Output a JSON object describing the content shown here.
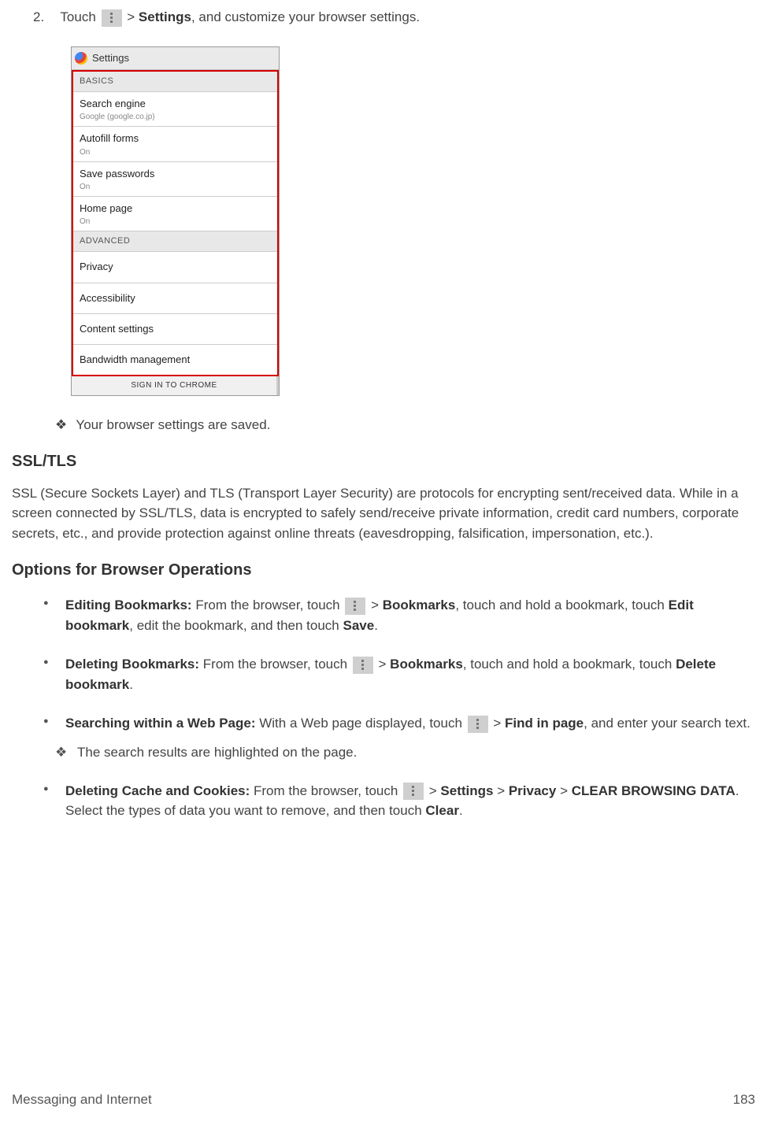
{
  "step": {
    "number": "2.",
    "pre": "Touch ",
    "post_gt": " > ",
    "settings": "Settings",
    "rest": ", and customize your browser settings."
  },
  "screenshot": {
    "title": "Settings",
    "section_basics": "BASICS",
    "items_basic": [
      {
        "title": "Search engine",
        "sub": "Google (google.co.jp)"
      },
      {
        "title": "Autofill forms",
        "sub": "On"
      },
      {
        "title": "Save passwords",
        "sub": "On"
      },
      {
        "title": "Home page",
        "sub": "On"
      }
    ],
    "section_advanced": "ADVANCED",
    "items_advanced": [
      "Privacy",
      "Accessibility",
      "Content settings",
      "Bandwidth management"
    ],
    "footer": "SIGN IN TO CHROME"
  },
  "saved_note": "Your browser settings are saved.",
  "ssl_heading": "SSL/TLS",
  "ssl_para": "SSL (Secure Sockets Layer) and TLS (Transport Layer Security) are protocols for encrypting sent/received data. While in a screen connected by SSL/TLS, data is encrypted to safely send/receive private information, credit card numbers, corporate secrets, etc., and provide protection against online threats (eavesdropping, falsification, impersonation, etc.).",
  "ops_heading": "Options for Browser Operations",
  "ops": {
    "edit": {
      "label": "Editing Bookmarks:",
      "t1": " From the browser, touch ",
      "gt": " > ",
      "b1": "Bookmarks",
      "t2": ", touch and hold a bookmark, touch ",
      "b2": "Edit bookmark",
      "t3": ", edit the bookmark, and then touch ",
      "b3": "Save",
      "t4": "."
    },
    "delete": {
      "label": "Deleting Bookmarks:",
      "t1": " From the browser, touch ",
      "gt": " > ",
      "b1": "Bookmarks",
      "t2": ", touch and hold a bookmark, touch ",
      "b2": "Delete bookmark",
      "t3": "."
    },
    "search": {
      "label": "Searching within a Web Page:",
      "t1": " With a Web page displayed, touch ",
      "gt": " > ",
      "b1": "Find in page",
      "t2": ", and enter your search text.",
      "note": "The search results are highlighted on the page."
    },
    "cache": {
      "label": "Deleting Cache and Cookies:",
      "t1": " From the browser, touch ",
      "gt": " > ",
      "b1": "Settings",
      "gt2": " > ",
      "b2": "Privacy",
      "gt3": " > ",
      "b3": "CLEAR BROWSING DATA",
      "t2": ". Select the types of data you want to remove, and then touch ",
      "b4": "Clear",
      "t3": "."
    }
  },
  "footer": {
    "left": "Messaging and Internet",
    "right": "183"
  }
}
